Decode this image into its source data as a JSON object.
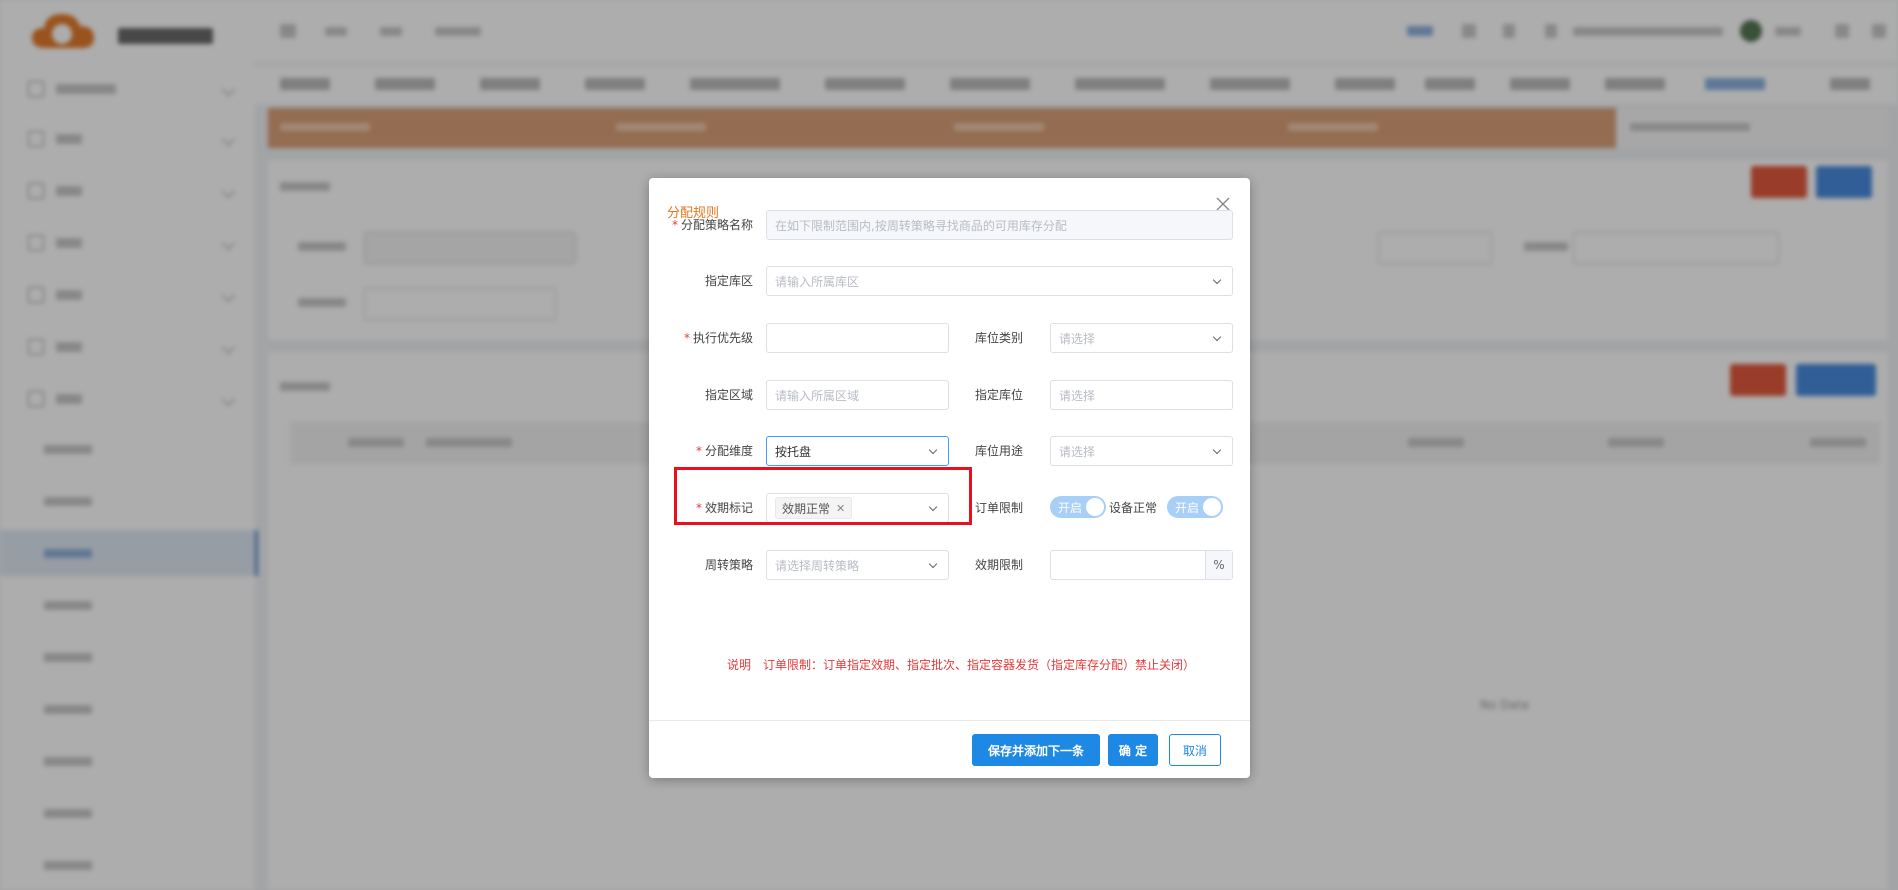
{
  "dialog": {
    "title": "分配规则",
    "fields": {
      "strategy_name": {
        "label": "分配策略名称",
        "required": true,
        "placeholder": "在如下限制范围内,按周转策略寻找商品的可用库存分配"
      },
      "zone": {
        "label": "指定库区",
        "placeholder": "请输入所属库区"
      },
      "priority": {
        "label": "执行优先级",
        "required": true,
        "value": ""
      },
      "location_type": {
        "label": "库位类别",
        "placeholder": "请选择"
      },
      "area": {
        "label": "指定区域",
        "placeholder": "请输入所属区域"
      },
      "location": {
        "label": "指定库位",
        "placeholder": "请选择"
      },
      "dimension": {
        "label": "分配维度",
        "required": true,
        "value": "按托盘"
      },
      "location_usage": {
        "label": "库位用途",
        "placeholder": "请选择"
      },
      "expiry_flag": {
        "label": "效期标记",
        "required": true,
        "tag": "效期正常"
      },
      "order_limit": {
        "label": "订单限制",
        "switch_text": "开启",
        "on": true
      },
      "device_normal": {
        "label": "设备正常",
        "switch_text": "开启",
        "on": true
      },
      "turnover": {
        "label": "周转策略",
        "placeholder": "请选择周转策略"
      },
      "expiry_limit": {
        "label": "效期限制",
        "value": "",
        "suffix": "%"
      }
    },
    "note_label": "说明",
    "note_text": "订单限制：订单指定效期、指定批次、指定容器发货（指定库存分配）禁止关闭）",
    "buttons": {
      "save_next": "保存并添加下一条",
      "confirm": "确 定",
      "cancel": "取消"
    }
  },
  "background": {
    "empty_table_text": "No Data"
  },
  "colors": {
    "accent_orange": "#e6761e",
    "primary_blue": "#1e88e5",
    "required_red": "#e23b3b",
    "highlight_red": "#e8101e"
  },
  "icons": [
    "close-icon",
    "chevron-down-icon",
    "tag-close-icon"
  ]
}
